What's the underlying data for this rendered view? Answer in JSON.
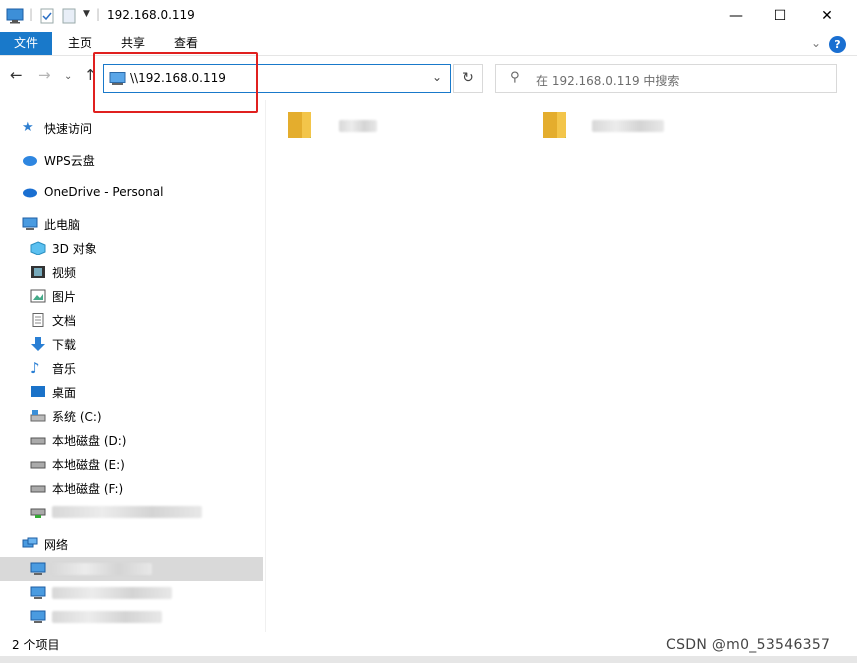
{
  "window": {
    "title": "192.168.0.119",
    "minimize": "—",
    "maximize": "☐",
    "close": "✕"
  },
  "ribbon": {
    "tabs": [
      "文件",
      "主页",
      "共享",
      "查看"
    ],
    "help": "?"
  },
  "address": {
    "path": "\\\\192.168.0.119",
    "search_placeholder": "在 192.168.0.119 中搜索"
  },
  "nav": {
    "quick_access": "快速访问",
    "wps": "WPS云盘",
    "onedrive": "OneDrive - Personal",
    "this_pc": "此电脑",
    "pc_items": [
      "3D 对象",
      "视频",
      "图片",
      "文档",
      "下载",
      "音乐",
      "桌面",
      "系统 (C:)",
      "本地磁盘 (D:)",
      "本地磁盘 (E:)",
      "本地磁盘 (F:)"
    ],
    "network": "网络"
  },
  "status": {
    "count": "2 个项目"
  },
  "watermark": "CSDN @m0_53546357",
  "colors": {
    "accent": "#1979ca",
    "highlight": "#e0201f",
    "selected_bg": "#d9d9d9"
  }
}
